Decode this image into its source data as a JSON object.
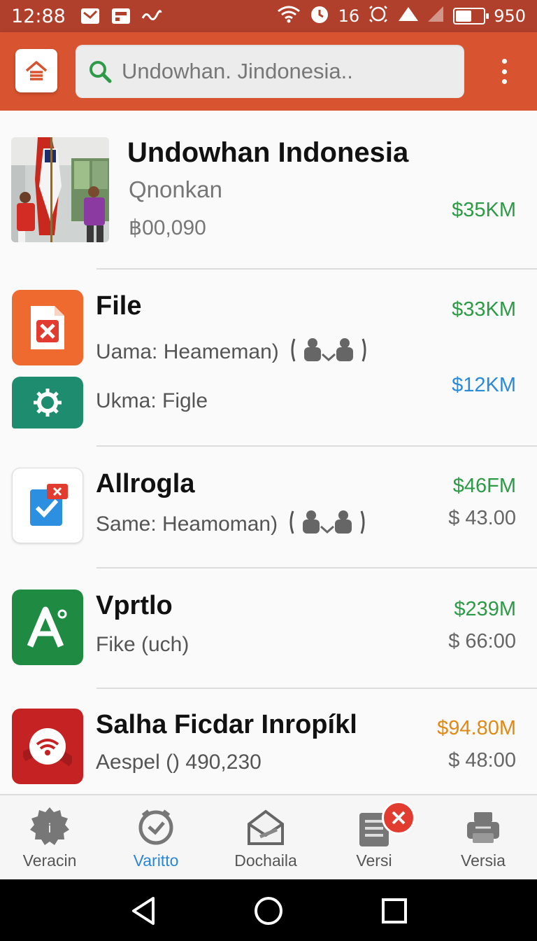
{
  "status_bar": {
    "time": "12:88",
    "signal_text": "16",
    "battery_text": "950",
    "battery_level": 0.55
  },
  "search": {
    "placeholder": "Undowhan. Jindonesia.."
  },
  "colors": {
    "accent": "#d8532f",
    "status": "#b0402c",
    "green": "#2e9a48",
    "blue": "#2c8bd8",
    "orange": "#e08a14"
  },
  "list": {
    "featured": {
      "title": "Undowhan Indonesia",
      "subtitle": "Qnonkan",
      "amount": "฿00,090",
      "price": "$35KM"
    },
    "items": [
      {
        "title": "File",
        "line1": "Uama: Heameman)",
        "line2": "Ukma: Figle",
        "price1": "$33KM",
        "price2": "$12KM",
        "icon": "file-x-icon",
        "icon2": "gear-chat-icon"
      },
      {
        "title": "Allrogla",
        "line1": "Same: Heamoman)",
        "price1": "$46FM",
        "price2": "$ 43.00",
        "icon": "checklist-icon"
      },
      {
        "title": "Vprtlo",
        "line1": "Fike (uch)",
        "price1": "$239M",
        "price2": "$ 66:00",
        "icon": "letter-a-icon"
      },
      {
        "title": "Salha Ficdar Inropíkl",
        "line1": "Aespel () 490,230",
        "price1": "$94.80M",
        "price2": "$ 48:00",
        "icon": "wifi-icon"
      }
    ]
  },
  "bottom_nav": [
    {
      "label": "Veracin",
      "icon": "gear-icon"
    },
    {
      "label": "Varitto",
      "icon": "clock-check-icon"
    },
    {
      "label": "Dochaila",
      "icon": "mail-icon"
    },
    {
      "label": "Versi",
      "icon": "document-list-icon"
    },
    {
      "label": "Versia",
      "icon": "printer-icon"
    }
  ]
}
